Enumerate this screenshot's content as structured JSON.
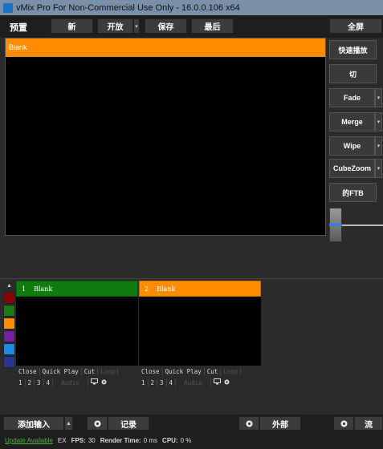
{
  "window": {
    "title": "vMix Pro For Non-Commercial Use Only - 16.0.0.106 x64"
  },
  "topbar": {
    "label": "预置",
    "new": "新",
    "open": "开放",
    "save": "保存",
    "recent": "最后",
    "fullscreen": "全屏",
    "dropdown_glyph": "▾"
  },
  "preview": {
    "title": "Blank",
    "header_color": "#ff8c00"
  },
  "transitions": {
    "quick_play": "快速播放",
    "cut": "切",
    "effects": [
      "Fade",
      "Merge",
      "Wipe",
      "CubeZoom"
    ],
    "ftb": "的FTB"
  },
  "color_tags": [
    "#8b0000",
    "#1a7a1a",
    "#ff8c00",
    "#7b1fa2",
    "#1e88e5",
    "#283593"
  ],
  "inputs": [
    {
      "number": "1",
      "title": "Blank",
      "color": "#107c10"
    },
    {
      "number": "2",
      "title": "Blank",
      "color": "#ff8c00"
    }
  ],
  "input_controls": {
    "close": "Close",
    "quick_play": "Quick Play",
    "cut": "Cut",
    "loop": "Loop",
    "audio": "Audio",
    "slots": [
      "1",
      "2",
      "3",
      "4"
    ]
  },
  "bottombar": {
    "add_input": "添加输入",
    "record": "记录",
    "external": "外部",
    "stream": "流"
  },
  "status": {
    "update": "Update Available",
    "ex": "EX",
    "fps_label": "FPS:",
    "fps_value": "30",
    "render_label": "Render Time:",
    "render_value": "0 ms",
    "cpu_label": "CPU:",
    "cpu_value": "0 %"
  }
}
